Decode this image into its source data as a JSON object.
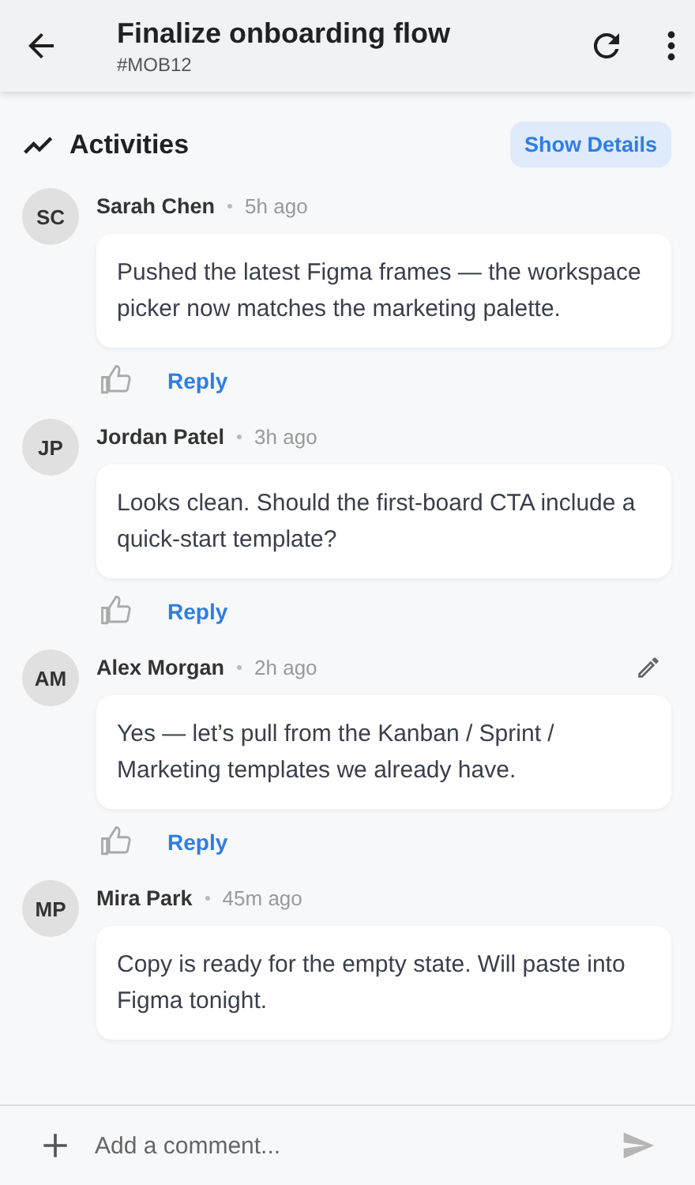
{
  "header": {
    "title": "Finalize onboarding flow",
    "subtitle": "#MOB12"
  },
  "section": {
    "title": "Activities",
    "button": "Show Details"
  },
  "comments": [
    {
      "initials": "SC",
      "author": "Sarah Chen",
      "time": "5h ago",
      "editable": false,
      "text": "Pushed the latest Figma frames — the workspace picker now matches the marketing palette.",
      "reply": "Reply"
    },
    {
      "initials": "JP",
      "author": "Jordan Patel",
      "time": "3h ago",
      "editable": false,
      "text": "Looks clean. Should the first-board CTA include a quick-start template?",
      "reply": "Reply"
    },
    {
      "initials": "AM",
      "author": "Alex Morgan",
      "time": "2h ago",
      "editable": true,
      "text": "Yes — let’s pull from the Kanban / Sprint / Marketing templates we already have.",
      "reply": "Reply"
    },
    {
      "initials": "MP",
      "author": "Mira Park",
      "time": "45m ago",
      "editable": false,
      "text": "Copy is ready for the empty state. Will paste into Figma tonight."
    }
  ],
  "composer": {
    "placeholder": "Add a comment..."
  }
}
